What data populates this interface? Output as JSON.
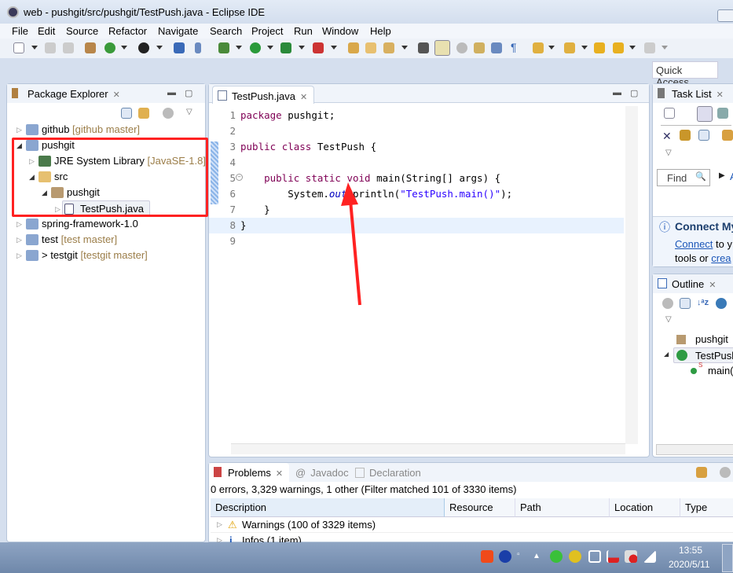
{
  "window": {
    "title": "web - pushgit/src/pushgit/TestPush.java - Eclipse IDE"
  },
  "menu": [
    "File",
    "Edit",
    "Source",
    "Refactor",
    "Navigate",
    "Search",
    "Project",
    "Run",
    "Window",
    "Help"
  ],
  "quick_access": "Quick Access",
  "package_explorer": {
    "title": "Package Explorer",
    "items": [
      {
        "label": "github",
        "decoration": "[github master]",
        "expanded": false
      },
      {
        "label": "pushgit",
        "decoration": "",
        "expanded": true
      },
      {
        "label": "JRE System Library",
        "decoration": "[JavaSE-1.8]",
        "expanded": false
      },
      {
        "label": "src",
        "decoration": "",
        "expanded": true
      },
      {
        "label": "pushgit",
        "decoration": "",
        "expanded": true
      },
      {
        "label": "TestPush.java",
        "decoration": "",
        "selected": true
      },
      {
        "label": "spring-framework-1.0",
        "decoration": ""
      },
      {
        "label": "test",
        "decoration": "[test master]"
      },
      {
        "label": "> testgit",
        "decoration": "[testgit master]"
      }
    ]
  },
  "editor": {
    "tab": "TestPush.java",
    "lines": [
      {
        "n": "1",
        "tokens": [
          [
            "package",
            "kw"
          ],
          [
            " pushgit;",
            "pl"
          ]
        ]
      },
      {
        "n": "2",
        "tokens": []
      },
      {
        "n": "3",
        "tokens": [
          [
            "public",
            "kw"
          ],
          [
            " ",
            "pl"
          ],
          [
            "class",
            "kw"
          ],
          [
            " TestPush {",
            "pl"
          ]
        ]
      },
      {
        "n": "4",
        "tokens": []
      },
      {
        "n": "5",
        "tokens": [
          [
            "    ",
            "pl"
          ],
          [
            "public",
            "kw"
          ],
          [
            " ",
            "pl"
          ],
          [
            "static",
            "kw"
          ],
          [
            " ",
            "pl"
          ],
          [
            "void",
            "kw"
          ],
          [
            " main(String[] args) {",
            "pl"
          ]
        ]
      },
      {
        "n": "6",
        "tokens": [
          [
            "        System.",
            "pl"
          ],
          [
            "out",
            "fld"
          ],
          [
            ".println(",
            "pl"
          ],
          [
            "\"TestPush.main()\"",
            "st"
          ],
          [
            ");",
            "pl"
          ]
        ]
      },
      {
        "n": "7",
        "tokens": [
          [
            "    }",
            "pl"
          ]
        ]
      },
      {
        "n": "8",
        "tokens": [
          [
            "}",
            "pl"
          ]
        ]
      },
      {
        "n": "9",
        "tokens": []
      }
    ]
  },
  "task_list": {
    "title": "Task List",
    "find_placeholder": "Find",
    "all_label": "A",
    "connect_title": "Connect My",
    "connect_link": "Connect",
    "connect_text": " to y",
    "tools_text": "tools or ",
    "create_link": "crea"
  },
  "outline": {
    "title": "Outline",
    "items": [
      "pushgit",
      "TestPush",
      "main("
    ]
  },
  "problems": {
    "tabs": [
      "Problems",
      "Javadoc",
      "Declaration"
    ],
    "summary": "0 errors, 3,329 warnings, 1 other (Filter matched 101 of 3330 items)",
    "columns": [
      "Description",
      "Resource",
      "Path",
      "Location",
      "Type"
    ],
    "rows": [
      "Warnings (100 of 3329 items)",
      "Infos (1 item)"
    ]
  },
  "taskbar": {
    "time": "13:55",
    "date": "2020/5/11"
  },
  "colors": {
    "highlight_box": "#ff2222",
    "arrow": "#ff2222"
  }
}
